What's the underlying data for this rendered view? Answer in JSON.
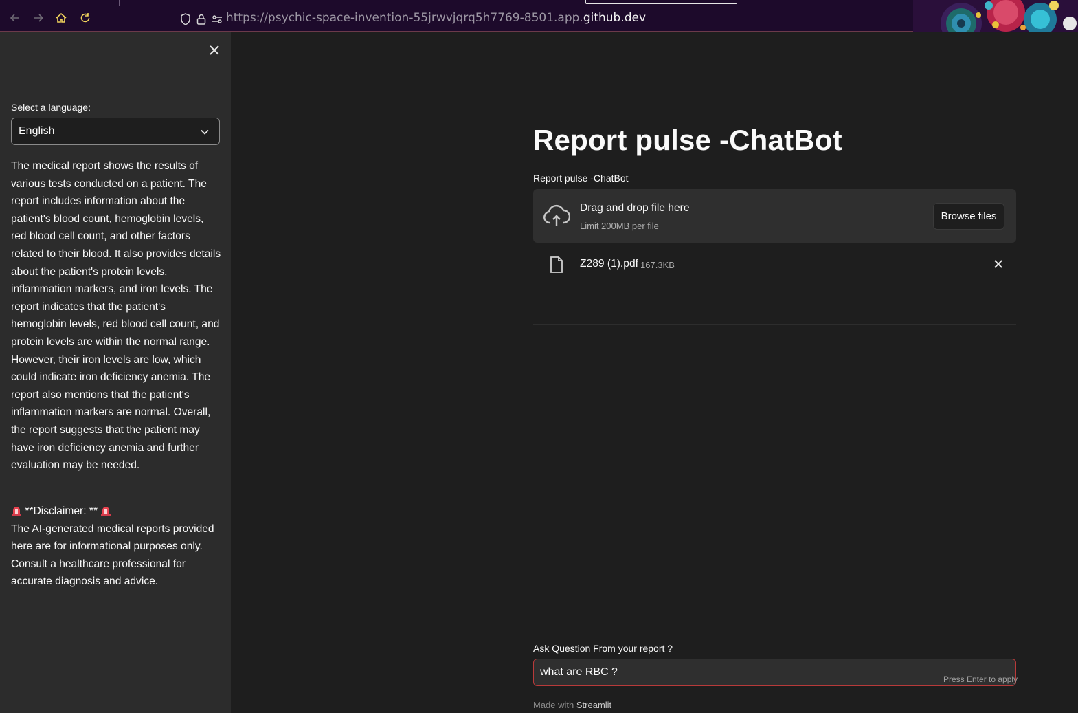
{
  "browser": {
    "url_prefix": "https://psychic-space-invention-55jrwvjqrq5h7769-8501.app.",
    "url_host": "github.dev"
  },
  "sidebar": {
    "language_label": "Select a language:",
    "language_value": "English",
    "summary": "The medical report shows the results of various tests conducted on a patient. The report includes information about the patient's blood count, hemoglobin levels, red blood cell count, and other factors related to their blood. It also provides details about the patient's protein levels, inflammation markers, and iron levels. The report indicates that the patient's hemoglobin levels, red blood cell count, and protein levels are within the normal range. However, their iron levels are low, which could indicate iron deficiency anemia. The report also mentions that the patient's inflammation markers are normal. Overall, the report suggests that the patient may have iron deficiency anemia and further evaluation may be needed.",
    "disclaimer_heading": " **Disclaimer: ** ",
    "disclaimer_text": "The AI-generated medical reports provided here are for informational purposes only. Consult a healthcare professional for accurate diagnosis and advice."
  },
  "main": {
    "title": "Report pulse -ChatBot",
    "uploader_label": "Report pulse -ChatBot",
    "drop_text": "Drag and drop file here",
    "drop_limit": "Limit 200MB per file",
    "browse_label": "Browse files",
    "file_name": "Z289 (1).pdf",
    "file_size": "167.3KB",
    "ask_label": "Ask Question From your report ?",
    "ask_value": "what are RBC ?",
    "ask_hint": "Press Enter to apply",
    "footer_prefix": "Made with",
    "footer_brand": "Streamlit"
  },
  "colors": {
    "accent_error_border": "#b83a3a",
    "sidebar_bg": "#2c2c2c",
    "main_bg": "#1e1e1e"
  },
  "icons": [
    "back-icon",
    "forward-icon",
    "home-icon",
    "reload-icon",
    "shield-icon",
    "lock-icon",
    "site-settings-icon",
    "close-icon",
    "chevron-down-icon",
    "siren-icon",
    "cloud-upload-icon",
    "file-icon"
  ]
}
